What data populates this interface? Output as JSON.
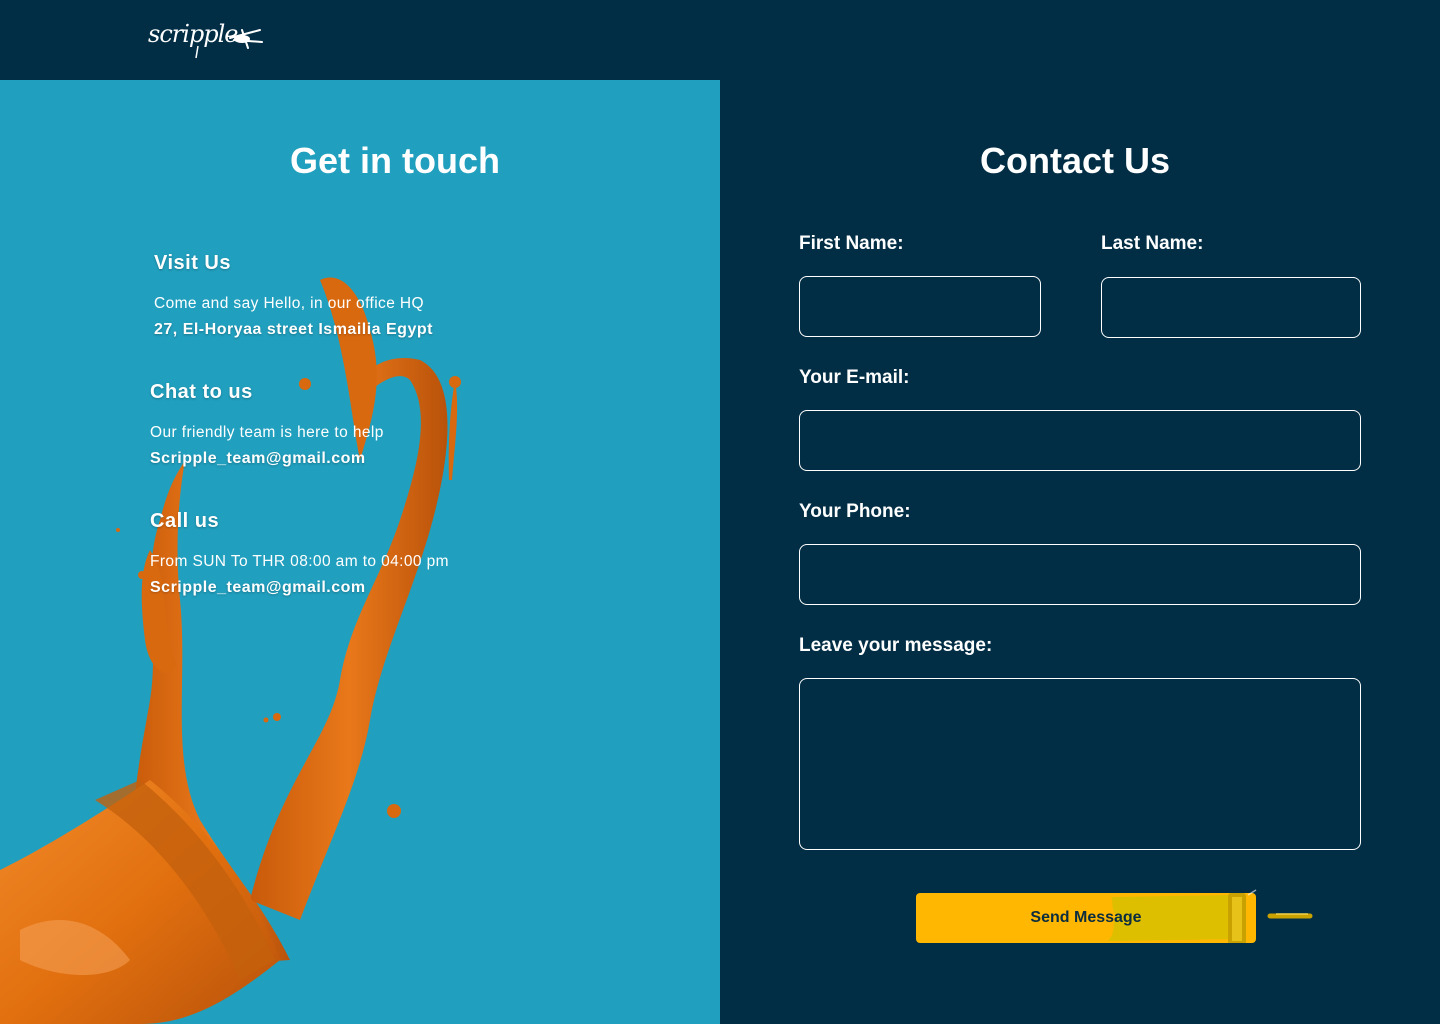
{
  "header": {
    "logo_text": "scripple",
    "logo_icon": "paint-roller-icon"
  },
  "left": {
    "title": "Get in touch",
    "visit": {
      "title": "Visit Us",
      "line": "Come and say Hello, in our office HQ",
      "strong": "27, El-Horyaa street Ismailia Egypt"
    },
    "chat": {
      "title": "Chat to us",
      "line": "Our friendly team is here to help",
      "strong": "Scripple_team@gmail.com"
    },
    "call": {
      "title": "Call us",
      "line": "From SUN To THR 08:00 am to 04:00 pm",
      "strong": "Scripple_team@gmail.com"
    }
  },
  "form": {
    "title": "Contact Us",
    "first_name_label": "First Name:",
    "last_name_label": "Last Name:",
    "email_label": "Your E-mail:",
    "phone_label": "Your Phone:",
    "message_label": "Leave your message:",
    "first_name_value": "",
    "last_name_value": "",
    "email_value": "",
    "phone_value": "",
    "message_value": "",
    "send_label": "Send Message"
  },
  "colors": {
    "background": "#022e45",
    "left_panel": "#219fbe",
    "accent": "#ffb702",
    "paint": "#d9690f"
  }
}
